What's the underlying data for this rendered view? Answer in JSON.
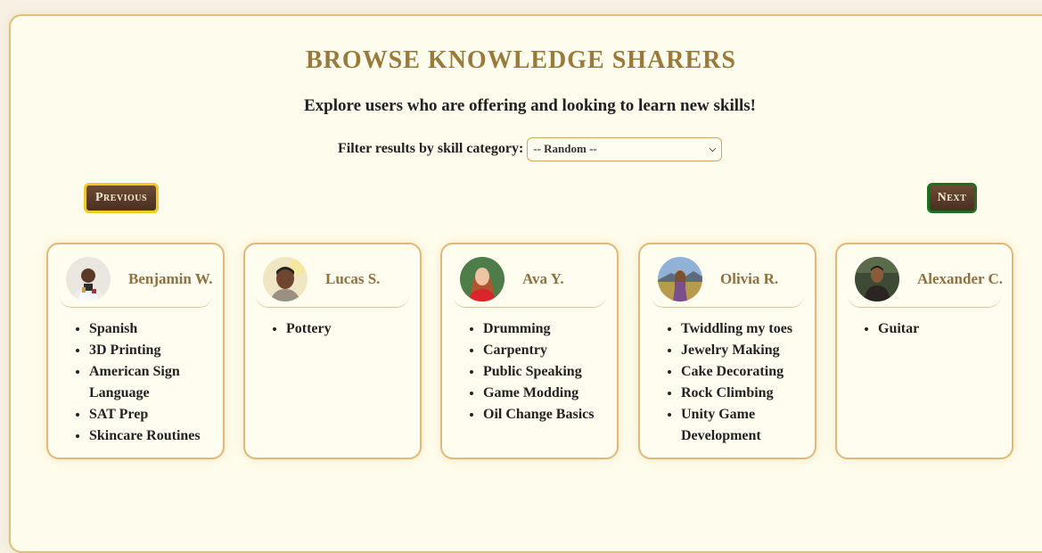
{
  "page": {
    "title": "BROWSE KNOWLEDGE SHARERS",
    "subtitle": "Explore users who are offering and looking to learn new skills!"
  },
  "filter": {
    "label": "Filter results by skill category:",
    "selected": "-- Random --"
  },
  "nav": {
    "previous_label": "Previous",
    "next_label": "Next"
  },
  "users": [
    {
      "name": "Benjamin W.",
      "skills": [
        "Spanish",
        "3D Printing",
        "American Sign Language",
        "SAT Prep",
        "Skincare Routines"
      ]
    },
    {
      "name": "Lucas S.",
      "skills": [
        "Pottery"
      ]
    },
    {
      "name": "Ava Y.",
      "skills": [
        "Drumming",
        "Carpentry",
        "Public Speaking",
        "Game Modding",
        "Oil Change Basics"
      ]
    },
    {
      "name": "Olivia R.",
      "skills": [
        "Twiddling my toes",
        "Jewelry Making",
        "Cake Decorating",
        "Rock Climbing",
        "Unity Game Development"
      ]
    },
    {
      "name": "Alexander C.",
      "skills": [
        "Guitar"
      ]
    }
  ],
  "colors": {
    "accent": "#9a7a3a",
    "card_border": "#deb979",
    "button_bg": "#5a3d28",
    "prev_border": "#f2c928",
    "next_border": "#1f6d1f"
  }
}
